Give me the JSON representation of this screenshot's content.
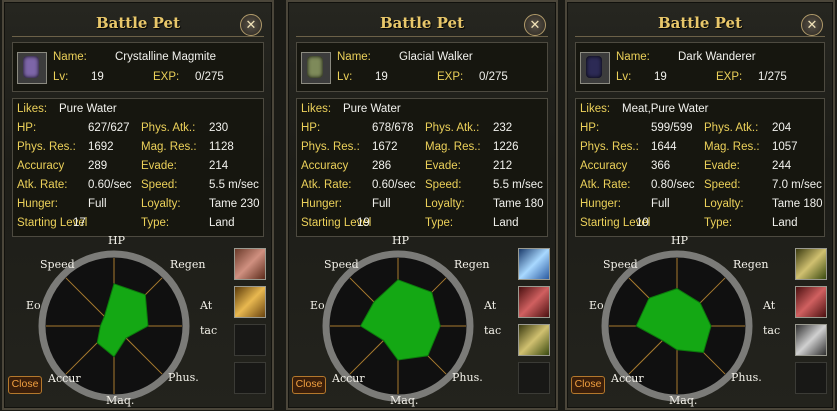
{
  "labels": {
    "title": "Battle Pet",
    "close_x": "✕",
    "name": "Name:",
    "lv": "Lv:",
    "exp": "EXP:",
    "likes": "Likes:",
    "hp": "HP:",
    "phys_res": "Phys. Res.:",
    "accuracy": "Accuracy",
    "atk_rate": "Atk. Rate:",
    "hunger": "Hunger:",
    "starting_level": "Starting Level",
    "phys_atk": "Phys. Atk.:",
    "mag_res": "Mag. Res.:",
    "evade": "Evade:",
    "speed": "Speed:",
    "loyalty": "Loyalty:",
    "type": "Type:",
    "close_button": "Close"
  },
  "radar_axes": {
    "hp": "HP",
    "regen": "Regen",
    "at": "At",
    "tac": "tac",
    "phus": "Phus.",
    "mag": "Maq.",
    "accur": "Accur",
    "eo": "Eo",
    "speed": "Speed"
  },
  "pets": [
    {
      "name": "Crystalline Magmite",
      "lv": "19",
      "exp": "0/275",
      "likes": "Pure Water",
      "hp": "627/627",
      "phys_res": "1692",
      "accuracy": "289",
      "atk_rate": "0.60/sec",
      "hunger": "Full",
      "starting_level": "17",
      "phys_atk": "230",
      "mag_res": "1128",
      "evade": "214",
      "speed": "5.5 m/sec",
      "loyalty": "Tame 230",
      "type": "Land",
      "portrait_color": "#7d66a8",
      "radar": [
        0.62,
        0.65,
        0.5,
        0.25,
        0.45,
        0.35,
        0.2,
        0.2
      ],
      "slots": [
        "pet-food-icon",
        "gold-scroll-icon",
        "empty",
        "empty"
      ]
    },
    {
      "name": "Glacial Walker",
      "lv": "19",
      "exp": "0/275",
      "likes": "Pure Water",
      "hp": "678/678",
      "phys_res": "1672",
      "accuracy": "286",
      "atk_rate": "0.60/sec",
      "hunger": "Full",
      "starting_level": "19",
      "phys_atk": "232",
      "mag_res": "1226",
      "evade": "212",
      "speed": "5.5 m/sec",
      "loyalty": "Tame 180",
      "type": "Land",
      "portrait_color": "#7e8a5a",
      "radar": [
        0.68,
        0.7,
        0.62,
        0.62,
        0.5,
        0.3,
        0.55,
        0.5
      ],
      "slots": [
        "ice-crystal-icon",
        "red-beast-icon",
        "wing-charm-icon",
        "empty"
      ]
    },
    {
      "name": "Dark Wanderer",
      "lv": "19",
      "exp": "1/275",
      "likes": "Meat,Pure Water",
      "hp": "599/599",
      "phys_res": "1644",
      "accuracy": "366",
      "atk_rate": "0.80/sec",
      "hunger": "Full",
      "starting_level": "10",
      "phys_atk": "204",
      "mag_res": "1057",
      "evade": "244",
      "speed": "7.0 m/sec",
      "loyalty": "Tame 180",
      "type": "Land",
      "portrait_color": "#2c2a55",
      "radar": [
        0.55,
        0.48,
        0.5,
        0.55,
        0.35,
        0.3,
        0.6,
        0.58
      ],
      "slots": [
        "wing-charm-icon",
        "red-beast-icon",
        "claw-icon",
        "empty"
      ]
    }
  ]
}
